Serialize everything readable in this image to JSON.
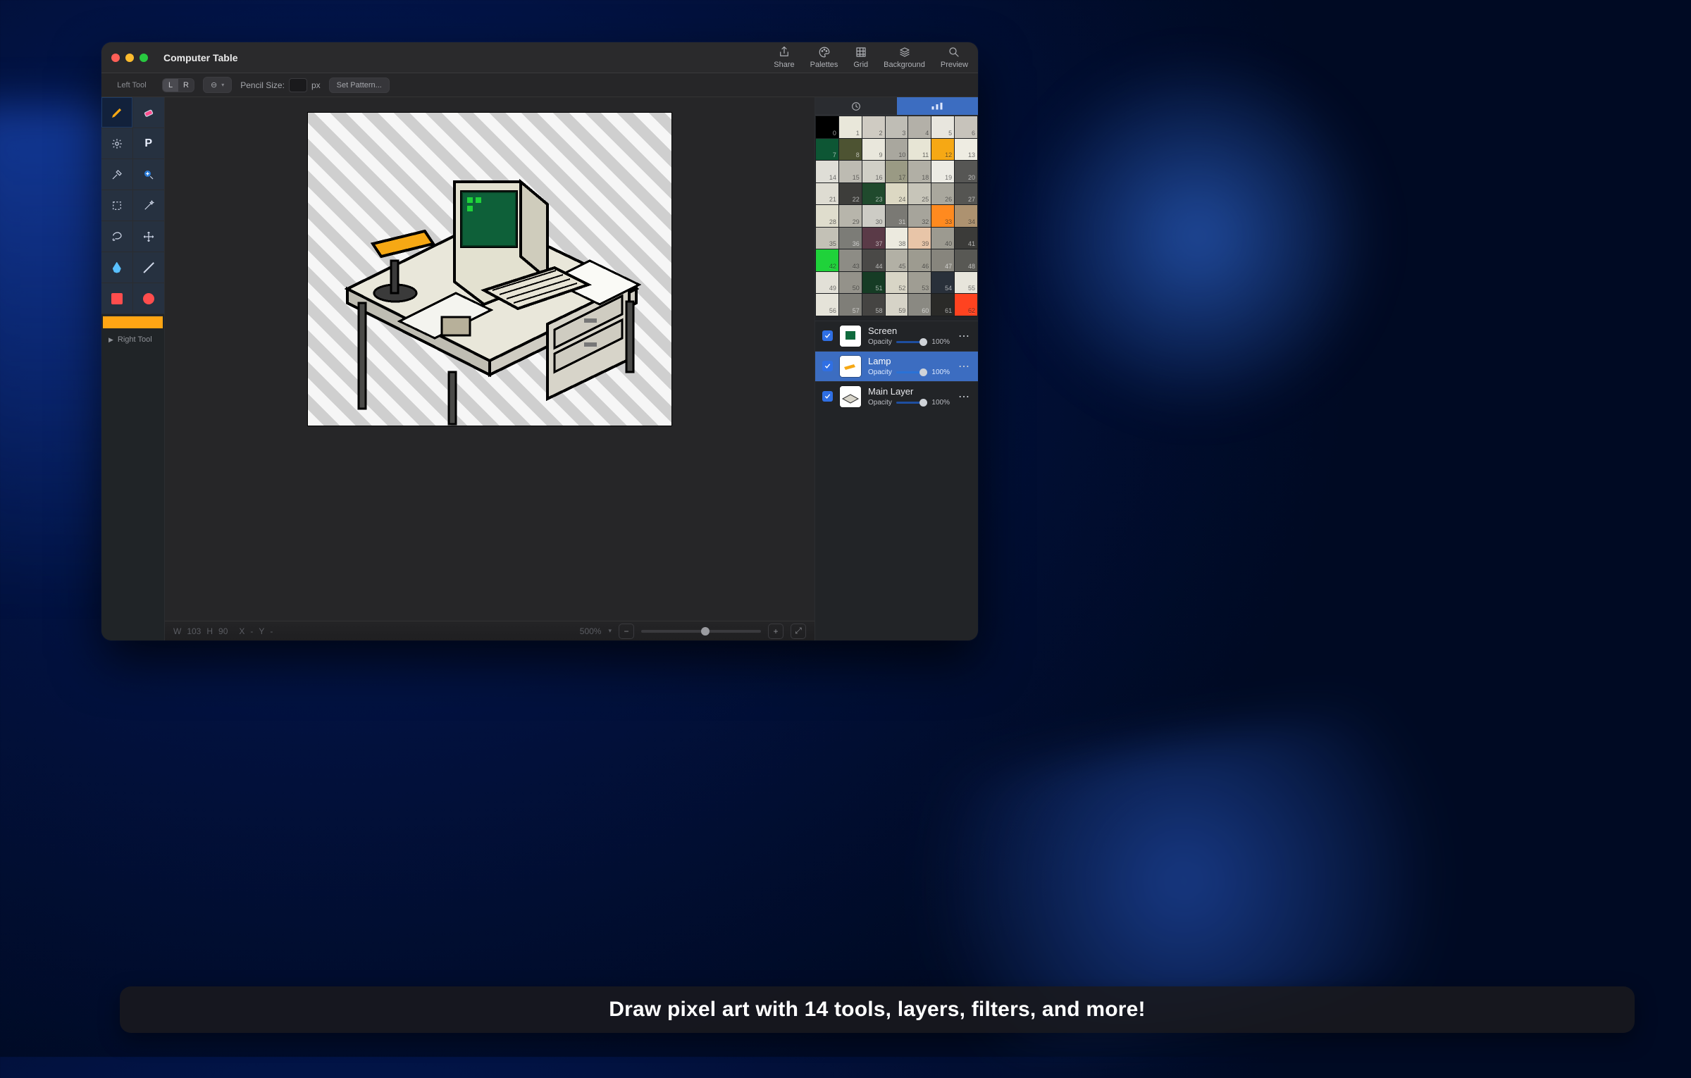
{
  "window": {
    "title": "Computer Table"
  },
  "title_actions": [
    {
      "id": "share",
      "label": "Share"
    },
    {
      "id": "palettes",
      "label": "Palettes"
    },
    {
      "id": "grid",
      "label": "Grid"
    },
    {
      "id": "background",
      "label": "Background"
    },
    {
      "id": "preview",
      "label": "Preview"
    }
  ],
  "option_bar": {
    "left_tool_label": "Left Tool",
    "lr": {
      "left": "L",
      "right": "R",
      "active": "L"
    },
    "mode_menu": "⊖",
    "pencil_size_label": "Pencil Size:",
    "pencil_size_value": "",
    "pencil_size_unit": "px",
    "set_pattern": "Set Pattern..."
  },
  "tools": [
    {
      "id": "pencil",
      "name": "pencil-tool",
      "active": true
    },
    {
      "id": "eraser",
      "name": "eraser-tool"
    },
    {
      "id": "light",
      "name": "lighten-tool"
    },
    {
      "id": "pattern",
      "name": "pattern-tool"
    },
    {
      "id": "eyedrop",
      "name": "eyedropper-tool"
    },
    {
      "id": "zoom",
      "name": "zoom-tool"
    },
    {
      "id": "marquee",
      "name": "rect-select-tool"
    },
    {
      "id": "wand",
      "name": "magic-wand-tool"
    },
    {
      "id": "lasso",
      "name": "lasso-tool"
    },
    {
      "id": "move",
      "name": "move-tool"
    },
    {
      "id": "blur",
      "name": "blur-tool"
    },
    {
      "id": "line",
      "name": "line-tool"
    },
    {
      "id": "rect",
      "name": "rect-shape-tool"
    },
    {
      "id": "ellipse",
      "name": "ellipse-shape-tool"
    }
  ],
  "right_tool_label": "Right Tool",
  "current_color": "#ffa514",
  "right_tabs": {
    "history": "history",
    "palette": "palette",
    "active": "palette"
  },
  "palette_count": 63,
  "palette": [
    {
      "i": 0,
      "c": "#000000",
      "d": 1
    },
    {
      "i": 1,
      "c": "#e9e7da"
    },
    {
      "i": 2,
      "c": "#cfcbc2"
    },
    {
      "i": 3,
      "c": "#bfbdb5"
    },
    {
      "i": 4,
      "c": "#b3b0a8"
    },
    {
      "i": 5,
      "c": "#e8e6de"
    },
    {
      "i": 6,
      "c": "#c7c3bb"
    },
    {
      "i": 7,
      "c": "#0d5634",
      "d": 1
    },
    {
      "i": 8,
      "c": "#4d5332",
      "d": 1
    },
    {
      "i": 9,
      "c": "#e9e7dc"
    },
    {
      "i": 10,
      "c": "#a9a79e"
    },
    {
      "i": 11,
      "c": "#e7e5d5"
    },
    {
      "i": 12,
      "c": "#f6a814"
    },
    {
      "i": 13,
      "c": "#eeece2"
    },
    {
      "i": 14,
      "c": "#dfded7"
    },
    {
      "i": 15,
      "c": "#bdbbb2"
    },
    {
      "i": 16,
      "c": "#d0cfc6"
    },
    {
      "i": 17,
      "c": "#9a9a84"
    },
    {
      "i": 18,
      "c": "#b1afa5"
    },
    {
      "i": 19,
      "c": "#ecebe4"
    },
    {
      "i": 20,
      "c": "#565654",
      "d": 1
    },
    {
      "i": 21,
      "c": "#dedcd2"
    },
    {
      "i": 22,
      "c": "#3d3d3a",
      "d": 1
    },
    {
      "i": 23,
      "c": "#204a2d",
      "d": 1
    },
    {
      "i": 24,
      "c": "#dcd8c3"
    },
    {
      "i": 25,
      "c": "#c7c5b9"
    },
    {
      "i": 26,
      "c": "#a9a79d"
    },
    {
      "i": 27,
      "c": "#555552",
      "d": 1
    },
    {
      "i": 28,
      "c": "#dfddcd"
    },
    {
      "i": 29,
      "c": "#b7b5ab"
    },
    {
      "i": 30,
      "c": "#cdccc5"
    },
    {
      "i": 31,
      "c": "#7a7974",
      "d": 1
    },
    {
      "i": 32,
      "c": "#a6a49b"
    },
    {
      "i": 33,
      "c": "#ff8a1f"
    },
    {
      "i": 34,
      "c": "#ad9270"
    },
    {
      "i": 35,
      "c": "#c3c1b6"
    },
    {
      "i": 36,
      "c": "#7c7c77",
      "d": 1
    },
    {
      "i": 37,
      "c": "#5a3a47",
      "d": 1
    },
    {
      "i": 38,
      "c": "#eceadf"
    },
    {
      "i": 39,
      "c": "#e8c5a8"
    },
    {
      "i": 40,
      "c": "#9c9a90"
    },
    {
      "i": 41,
      "c": "#3b3b39",
      "d": 1
    },
    {
      "i": 42,
      "c": "#1fd23a"
    },
    {
      "i": 43,
      "c": "#8d8c85"
    },
    {
      "i": 44,
      "c": "#4a4947",
      "d": 1
    },
    {
      "i": 45,
      "c": "#b2b0a5"
    },
    {
      "i": 46,
      "c": "#9d9b90"
    },
    {
      "i": 47,
      "c": "#87857d",
      "d": 1
    },
    {
      "i": 48,
      "c": "#585854",
      "d": 1
    },
    {
      "i": 49,
      "c": "#e2e0d7"
    },
    {
      "i": 50,
      "c": "#94928a"
    },
    {
      "i": 51,
      "c": "#163c25",
      "d": 1
    },
    {
      "i": 52,
      "c": "#d8d5c6"
    },
    {
      "i": 53,
      "c": "#9f9d93"
    },
    {
      "i": 54,
      "c": "#29303a",
      "d": 1
    },
    {
      "i": 55,
      "c": "#e7e5db"
    },
    {
      "i": 56,
      "c": "#e5e3d9"
    },
    {
      "i": 57,
      "c": "#7f7e78",
      "d": 1
    },
    {
      "i": 58,
      "c": "#454442",
      "d": 1
    },
    {
      "i": 59,
      "c": "#d6d3c7"
    },
    {
      "i": 60,
      "c": "#8a8982",
      "d": 1
    },
    {
      "i": 61,
      "c": "#2a2a28",
      "d": 1
    },
    {
      "i": 62,
      "c": "#ff4320"
    }
  ],
  "layers": [
    {
      "name": "Screen",
      "opacity_label": "Opacity",
      "opacity_pct": "100%",
      "checked": true,
      "selected": false
    },
    {
      "name": "Lamp",
      "opacity_label": "Opacity",
      "opacity_pct": "100%",
      "checked": true,
      "selected": true
    },
    {
      "name": "Main Layer",
      "opacity_label": "Opacity",
      "opacity_pct": "100%",
      "checked": true,
      "selected": false
    }
  ],
  "status": {
    "w_label": "W",
    "w": "103",
    "h_label": "H",
    "h": "90",
    "x_label": "X",
    "x": "-",
    "y_label": "Y",
    "y": "-",
    "zoom": "500%"
  },
  "banner": "Draw pixel art with 14 tools, layers, filters, and more!"
}
